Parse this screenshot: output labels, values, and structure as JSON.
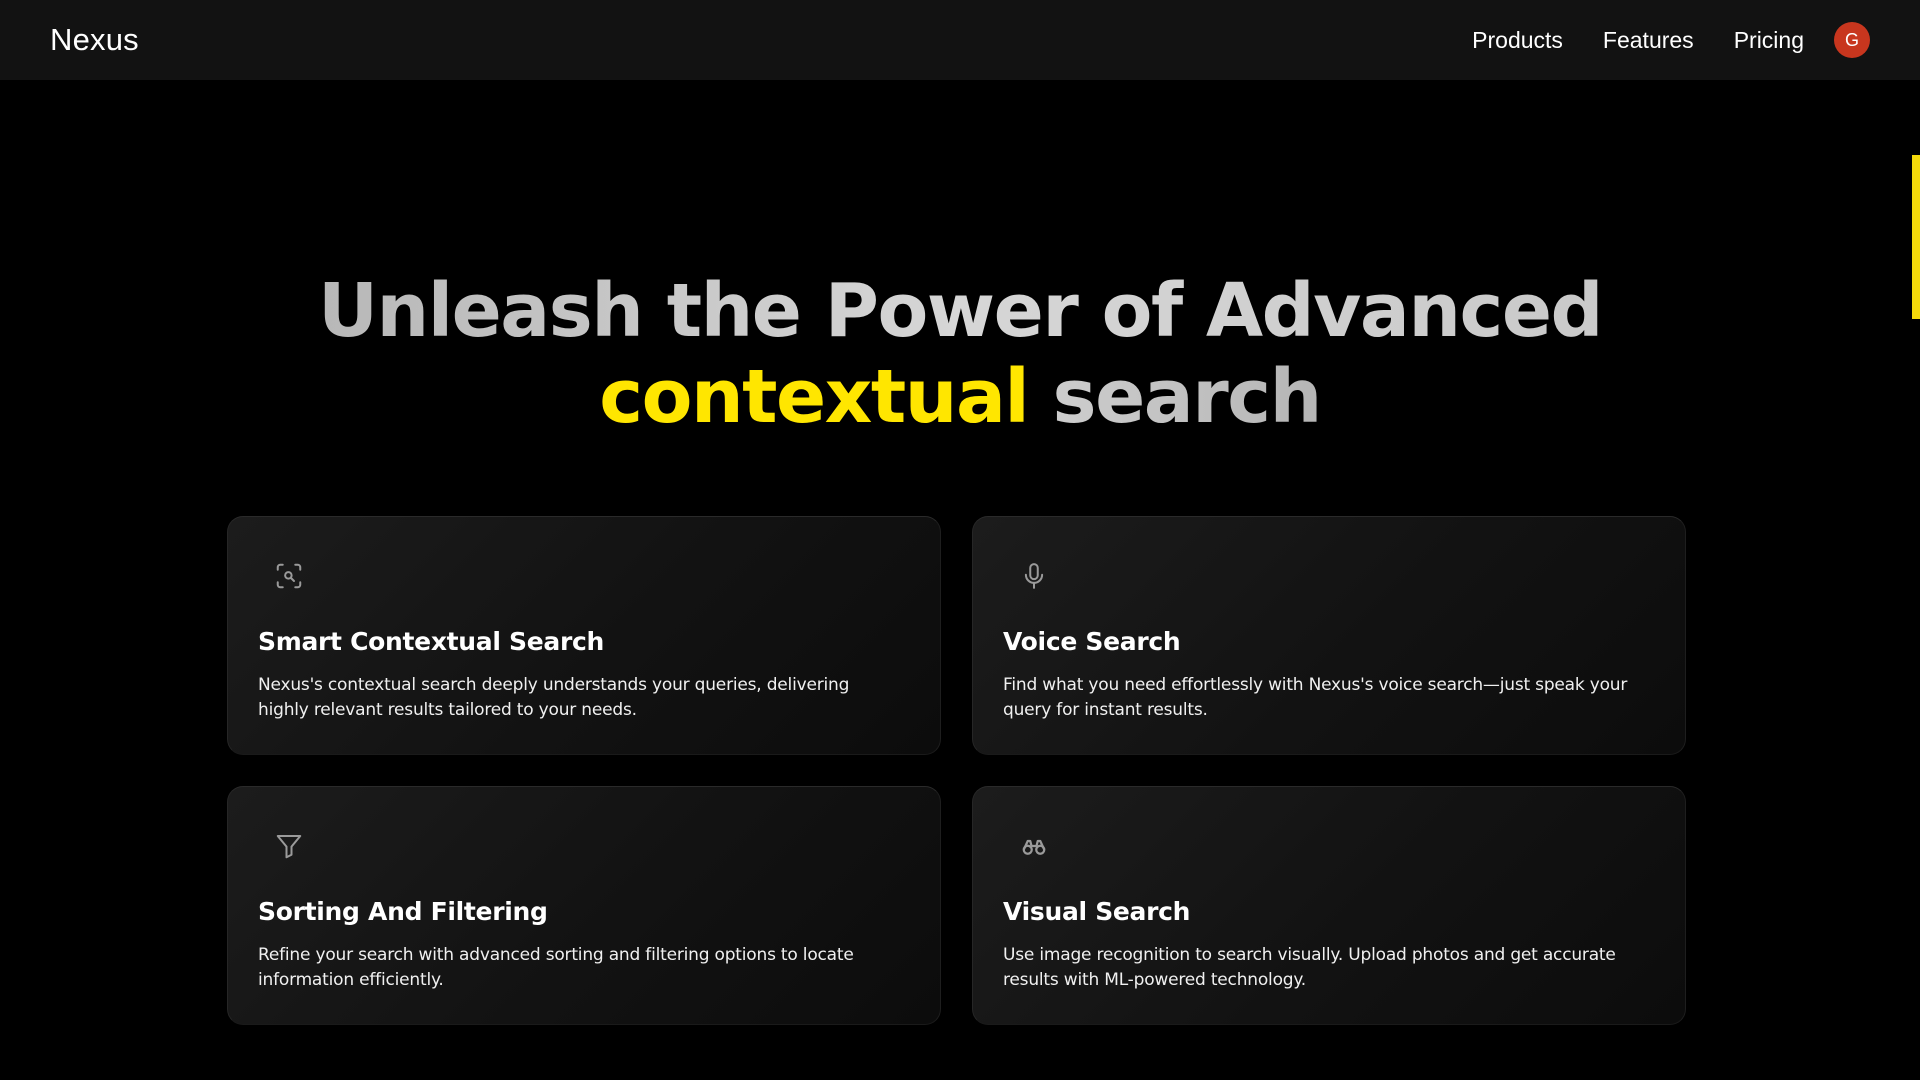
{
  "header": {
    "brand": "Nexus",
    "nav": [
      "Products",
      "Features",
      "Pricing"
    ],
    "avatar_initial": "G"
  },
  "hero": {
    "line1": "Unleash the Power of Advanced",
    "accent": "contextual",
    "rest": " search"
  },
  "features": [
    {
      "icon": "scan-search-icon",
      "title": "Smart Contextual Search",
      "description": "Nexus's contextual search deeply understands your queries, delivering highly relevant results tailored to your needs."
    },
    {
      "icon": "microphone-icon",
      "title": "Voice Search",
      "description": "Find what you need effortlessly with Nexus's voice search—just speak your query for instant results."
    },
    {
      "icon": "filter-icon",
      "title": "Sorting And Filtering",
      "description": "Refine your search with advanced sorting and filtering options to locate information efficiently."
    },
    {
      "icon": "binoculars-icon",
      "title": "Visual Search",
      "description": "Use image recognition to search visually. Upload photos and get accurate results with ML-powered technology."
    }
  ],
  "colors": {
    "accent": "#ffe600",
    "avatar": "#c8361e",
    "background": "#000000",
    "header": "#121212"
  }
}
